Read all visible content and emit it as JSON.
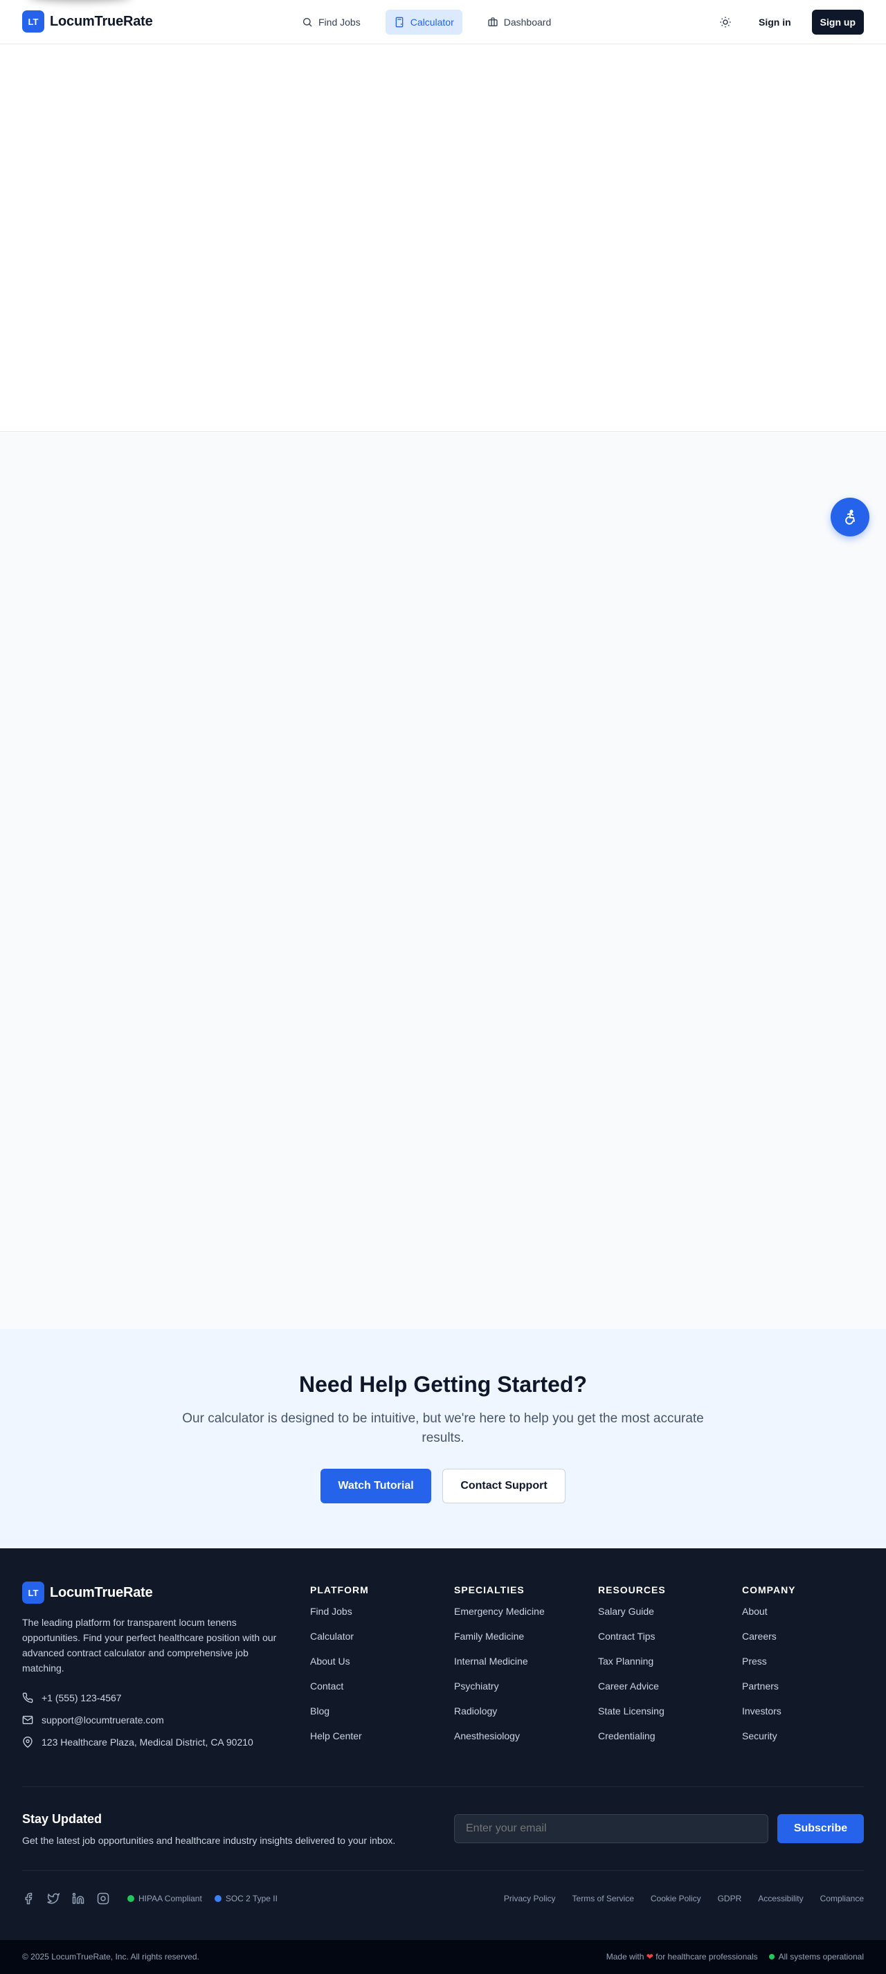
{
  "brand": {
    "badge": "LT",
    "name": "LocumTrueRate"
  },
  "nav": {
    "links": [
      {
        "label": "Find Jobs",
        "icon": "search-icon"
      },
      {
        "label": "Calculator",
        "icon": "calculator-icon",
        "active": true
      },
      {
        "label": "Dashboard",
        "icon": "briefcase-icon"
      }
    ],
    "theme_icon": "sun-icon",
    "signin": "Sign in",
    "signup": "Sign up"
  },
  "accessibility_button_icon": "accessibility-icon",
  "help": {
    "title": "Need Help Getting Started?",
    "description": "Our calculator is designed to be intuitive, but we're here to help you get the most accurate results.",
    "watch_tutorial": "Watch Tutorial",
    "contact_support": "Contact Support"
  },
  "footer": {
    "description": "The leading platform for transparent locum tenens opportunities. Find your perfect healthcare position with our advanced contract calculator and comprehensive job matching.",
    "phone": "+1 (555) 123-4567",
    "email": "support@locumtruerate.com",
    "address": "123 Healthcare Plaza, Medical District, CA 90210",
    "columns": [
      {
        "title": "PLATFORM",
        "links": [
          "Find Jobs",
          "Calculator",
          "About Us",
          "Contact",
          "Blog",
          "Help Center"
        ]
      },
      {
        "title": "SPECIALTIES",
        "links": [
          "Emergency Medicine",
          "Family Medicine",
          "Internal Medicine",
          "Psychiatry",
          "Radiology",
          "Anesthesiology"
        ]
      },
      {
        "title": "RESOURCES",
        "links": [
          "Salary Guide",
          "Contract Tips",
          "Tax Planning",
          "Career Advice",
          "State Licensing",
          "Credentialing"
        ]
      },
      {
        "title": "COMPANY",
        "links": [
          "About",
          "Careers",
          "Press",
          "Partners",
          "Investors",
          "Security"
        ]
      }
    ],
    "newsletter": {
      "title": "Stay Updated",
      "text": "Get the latest job opportunities and healthcare industry insights delivered to your inbox.",
      "placeholder": "Enter your email",
      "button": "Subscribe"
    },
    "socials": [
      "facebook-icon",
      "twitter-icon",
      "linkedin-icon",
      "instagram-icon"
    ],
    "badges": [
      {
        "label": "HIPAA Compliant",
        "color": "#22c55e"
      },
      {
        "label": "SOC 2 Type II",
        "color": "#3b82f6"
      }
    ],
    "legal": [
      "Privacy Policy",
      "Terms of Service",
      "Cookie Policy",
      "GDPR",
      "Accessibility",
      "Compliance"
    ],
    "copyright": "© 2025 LocumTrueRate, Inc. All rights reserved.",
    "made_with_prefix": "Made with",
    "made_with_suffix": "for healthcare professionals",
    "status": "All systems operational",
    "status_color": "#22c55e"
  },
  "colors": {
    "primary": "#2563eb",
    "dark": "#0f172a",
    "footer_bg": "#111827"
  }
}
